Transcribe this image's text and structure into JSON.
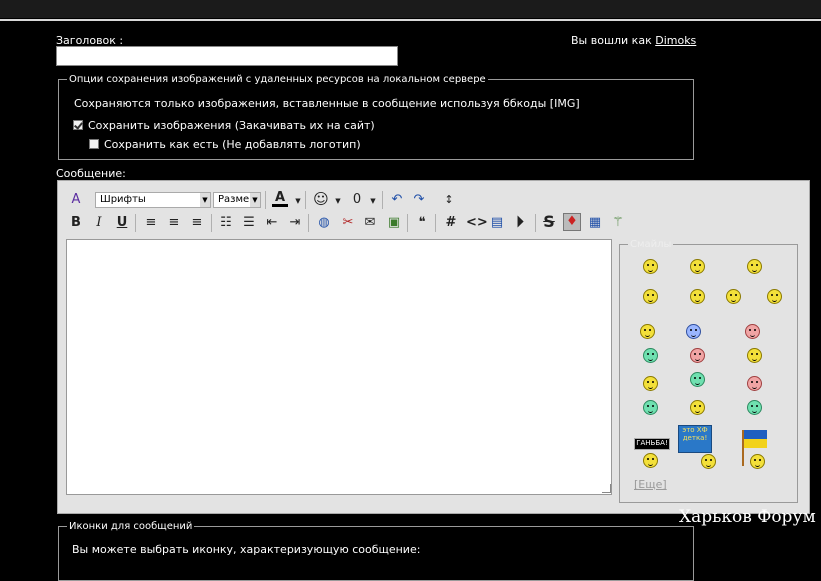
{
  "header": {
    "title_label": "Заголовок :",
    "logged_prefix": "Вы вошли как",
    "username": "Dimoks"
  },
  "title_input": {
    "value": "",
    "placeholder": ""
  },
  "image_options": {
    "legend": "Опции сохранения изображений с удаленных ресурсов на локальном сервере",
    "description": "Сохраняются только изображения, вставленные в сообщение используя ббкоды [IMG]",
    "save_images": {
      "label": "Сохранить изображения (Закачивать их на сайт)",
      "checked": true
    },
    "save_as_is": {
      "label": "Сохранить как есть (Не добавлять логотип)",
      "checked": false
    }
  },
  "editor": {
    "label": "Сообщение:",
    "font_select": "Шрифты",
    "size_select": "Размер",
    "textarea_value": ""
  },
  "smilies": {
    "legend": "Смайлы",
    "more_link": "[Еще]",
    "banner_1": "ГАНЬБА!",
    "banner_2": "это ХФ детка!"
  },
  "watermark": "Харьков Форум",
  "message_icons": {
    "legend": "Иконки для сообщений",
    "description": "Вы можете выбрать иконку, характеризующую сообщение:"
  },
  "colors": {
    "background": "#000000",
    "editor_bg": "#e3e3e3",
    "smiley_yellow": "#f3e03a"
  }
}
